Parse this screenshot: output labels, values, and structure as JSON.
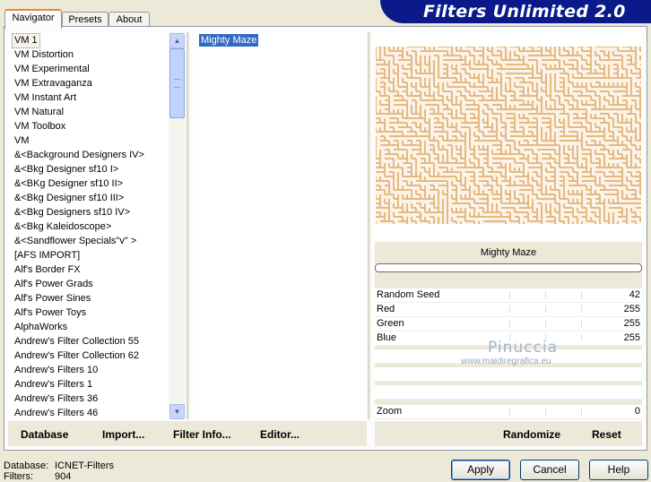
{
  "app": {
    "title": "Filters Unlimited 2.0"
  },
  "tabs": [
    {
      "label": "Navigator"
    },
    {
      "label": "Presets"
    },
    {
      "label": "About"
    }
  ],
  "categories": [
    "VM 1",
    "VM Distortion",
    "VM Experimental",
    "VM Extravaganza",
    "VM Instant Art",
    "VM Natural",
    "VM Toolbox",
    "VM",
    "&<Background Designers IV>",
    "&<Bkg Designer sf10 I>",
    "&<BKg Designer sf10 II>",
    "&<Bkg Designer sf10 III>",
    "&<Bkg Designers sf10 IV>",
    "&<Bkg Kaleidoscope>",
    "&<Sandflower Specials\"v\" >",
    "[AFS IMPORT]",
    "Alf's Border FX",
    "Alf's Power Grads",
    "Alf's Power Sines",
    "Alf's Power Toys",
    "AlphaWorks",
    "Andrew's Filter Collection 55",
    "Andrew's Filter Collection 62",
    "Andrew's Filters 10",
    "Andrew's Filters 1",
    "Andrew's Filters 36",
    "Andrew's Filters 46"
  ],
  "selected_category": "VM 1",
  "filters": [
    "Mighty Maze"
  ],
  "selected_filter": "Mighty Maze",
  "preview": {
    "filter_name": "Mighty Maze",
    "maze_color": "#e6b983",
    "background": "#ffffff"
  },
  "params": [
    {
      "label": "Random Seed",
      "value": "42"
    },
    {
      "label": "Red",
      "value": "255"
    },
    {
      "label": "Green",
      "value": "255"
    },
    {
      "label": "Blue",
      "value": "255"
    },
    {
      "label": "",
      "value": ""
    },
    {
      "label": "",
      "value": ""
    },
    {
      "label": "",
      "value": ""
    },
    {
      "label": "Zoom",
      "value": "0"
    }
  ],
  "left_actions": {
    "database": "Database",
    "import": "Import...",
    "filter_info": "Filter Info...",
    "editor": "Editor..."
  },
  "right_actions": {
    "randomize": "Randomize",
    "reset": "Reset"
  },
  "status": {
    "database_label": "Database:",
    "database_value": "ICNET-Filters",
    "filters_label": "Filters:",
    "filters_value": "904"
  },
  "dialog": {
    "apply": "Apply",
    "cancel": "Cancel",
    "help": "Help"
  },
  "watermark": {
    "line1": "Pinuccia",
    "line2": "www.maidiregrafica.eu"
  },
  "colors": {
    "banner": "#0a1a8a",
    "selection": "#316ac5",
    "dialog_bg": "#ece9d8"
  }
}
